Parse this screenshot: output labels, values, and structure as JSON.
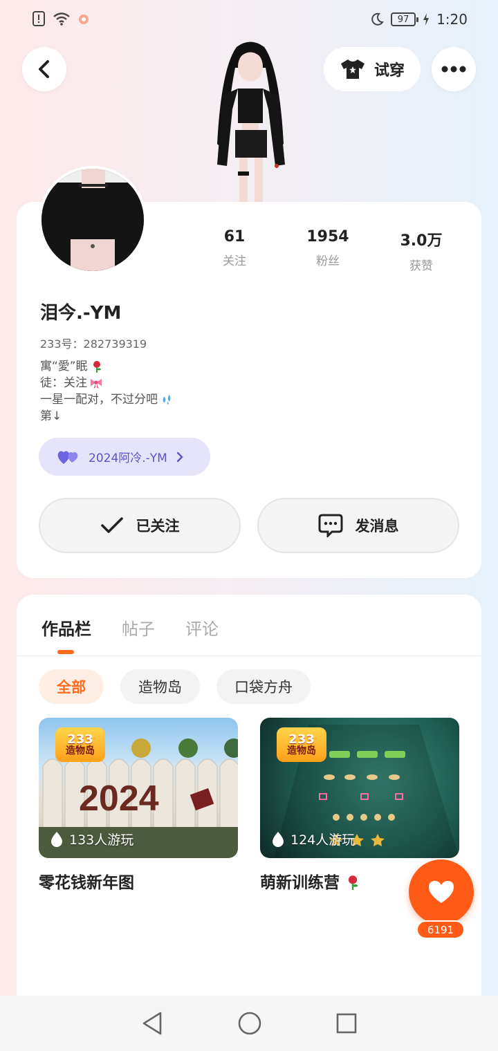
{
  "status_bar": {
    "battery": "97",
    "time": "1:20"
  },
  "header": {
    "tryon_label": "试穿"
  },
  "profile": {
    "stats": [
      {
        "value": "61",
        "label": "关注"
      },
      {
        "value": "1954",
        "label": "粉丝"
      },
      {
        "value": "3.0万",
        "label": "获赞"
      }
    ],
    "nickname": "泪今.-YM",
    "uid": "233号：282739319",
    "bio": [
      "寓“愛”眠",
      "徒：关注",
      "一星一配对，不过分吧",
      "第↓"
    ],
    "cp_chip": "2024阿冷.-YM",
    "follow_label": "已关注",
    "message_label": "发消息"
  },
  "works": {
    "tabs": [
      "作品栏",
      "帖子",
      "评论"
    ],
    "filters": [
      "全部",
      "造物岛",
      "口袋方舟"
    ],
    "items": [
      {
        "title": "零花钱新年图",
        "plays": "133人游玩",
        "badge_top": "233",
        "badge_bottom": "造物岛",
        "year_text": "2024"
      },
      {
        "title": "萌新训练营",
        "plays": "124人游玩",
        "badge_top": "233",
        "badge_bottom": "造物岛"
      }
    ]
  },
  "like": {
    "count": "6191"
  },
  "colors": {
    "accent": "#ff5a16",
    "chip_text": "#5a53c9",
    "chip_bg": "#e6e4fb"
  }
}
